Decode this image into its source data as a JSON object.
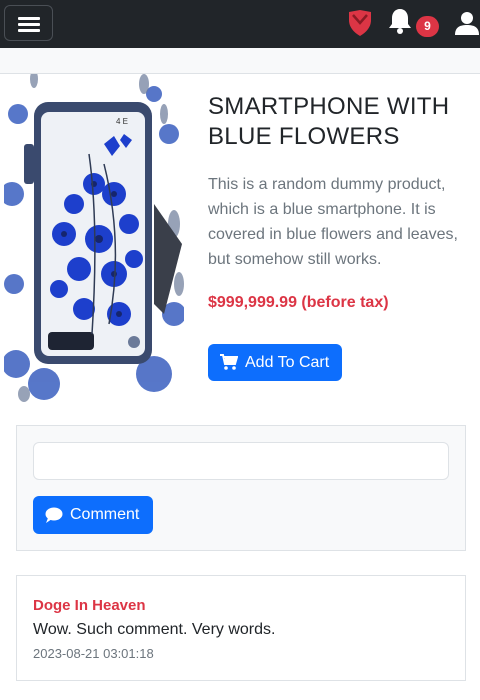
{
  "navbar": {
    "menu_icon": "hamburger-menu-icon",
    "shield_icon": "shield-icon",
    "bell_icon": "bell-icon",
    "notification_count": "9",
    "user_icon": "user-icon",
    "background": "#212529"
  },
  "product": {
    "image_alt": "smartphone covered in blue flowers",
    "title": "SMARTPHONE WITH BLUE FLOWERS",
    "description": "This is a random dummy product, which is a blue smartphone. It is covered in blue flowers and leaves, but somehow still works.",
    "price": "$999,999.99 (before tax)",
    "add_to_cart_label": "Add To Cart",
    "cart_icon": "cart-icon"
  },
  "comment_form": {
    "input_value": "",
    "input_placeholder": "",
    "submit_label": "Comment",
    "comment_icon": "speech-bubble-icon"
  },
  "comments": [
    {
      "author": "Doge In Heaven",
      "text": "Wow. Such comment. Very words.",
      "timestamp": "2023-08-21 03:01:18"
    }
  ],
  "colors": {
    "primary": "#0d6efd",
    "danger": "#dc3545",
    "muted": "#6c757d"
  }
}
